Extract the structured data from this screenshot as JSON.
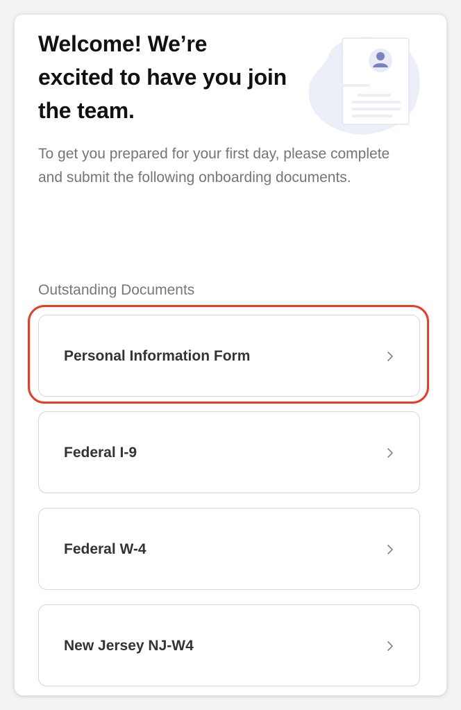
{
  "header": {
    "title": "Welcome! We’re excited to have you join the team.",
    "intro": "To get you prepared for your first day, please complete and submit the following onboarding documents."
  },
  "illustration": {
    "icon": "resume-document-icon",
    "blob_color": "#eceef8",
    "accent_color": "#7b82c2"
  },
  "documents": {
    "section_label": "Outstanding Documents",
    "items": [
      {
        "label": "Personal Information Form",
        "icon": "chevron-right-icon",
        "highlighted": true
      },
      {
        "label": "Federal I-9",
        "icon": "chevron-right-icon"
      },
      {
        "label": "Federal W-4",
        "icon": "chevron-right-icon"
      },
      {
        "label": "New Jersey NJ-W4",
        "icon": "chevron-right-icon"
      }
    ]
  },
  "colors": {
    "highlight": "#ee3a1f",
    "title": "#111111",
    "muted_text": "#757575",
    "card_border": "#d6d6d6"
  }
}
